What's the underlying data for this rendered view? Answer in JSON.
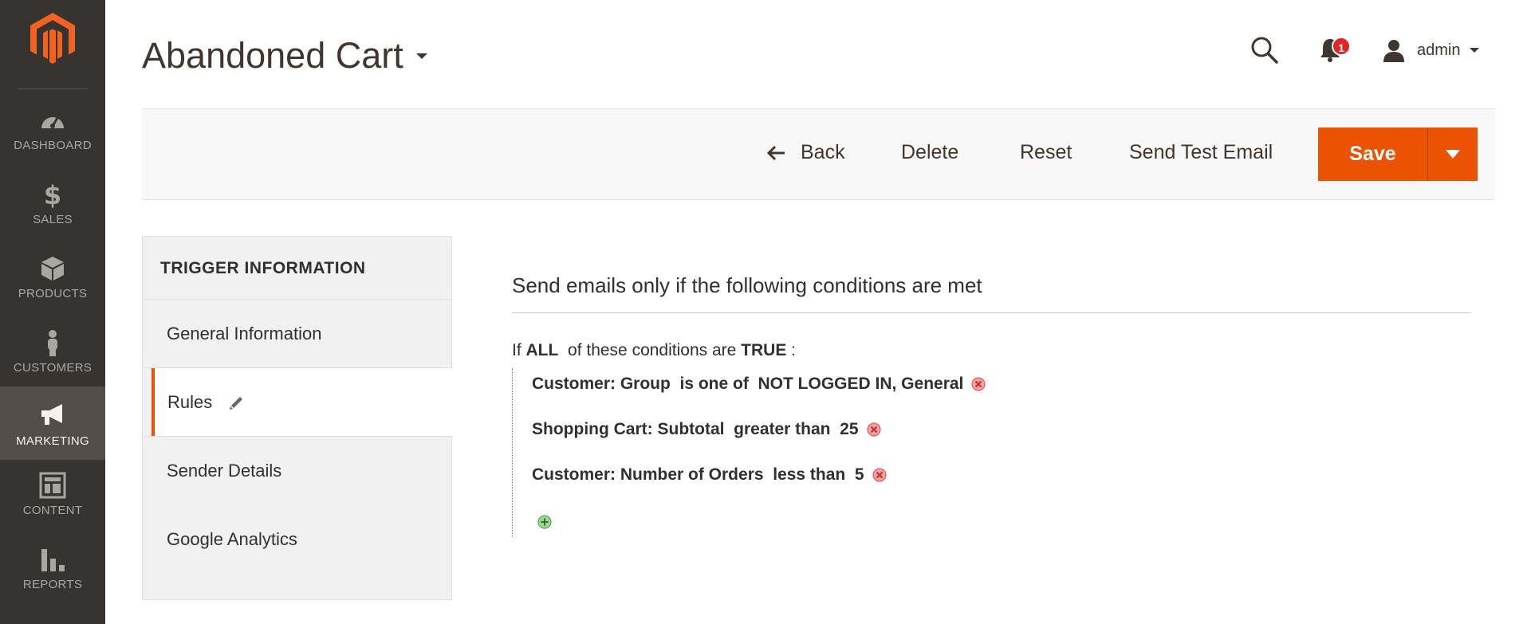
{
  "sidebar": {
    "logo": "magento-logo",
    "items": [
      {
        "label": "DASHBOARD",
        "icon": "dashboard-icon"
      },
      {
        "label": "SALES",
        "icon": "dollar-icon"
      },
      {
        "label": "PRODUCTS",
        "icon": "box-icon"
      },
      {
        "label": "CUSTOMERS",
        "icon": "person-icon"
      },
      {
        "label": "MARKETING",
        "icon": "megaphone-icon",
        "active": true
      },
      {
        "label": "CONTENT",
        "icon": "layout-icon"
      },
      {
        "label": "REPORTS",
        "icon": "bar-chart-icon"
      }
    ]
  },
  "header": {
    "title": "Abandoned Cart",
    "notification_count": "1",
    "user_name": "admin"
  },
  "toolbar": {
    "back_label": "Back",
    "delete_label": "Delete",
    "reset_label": "Reset",
    "send_test_label": "Send Test Email",
    "save_label": "Save"
  },
  "tabs": {
    "title": "TRIGGER INFORMATION",
    "items": [
      {
        "label": "General Information"
      },
      {
        "label": "Rules",
        "active": true
      },
      {
        "label": "Sender Details"
      },
      {
        "label": "Google Analytics"
      }
    ]
  },
  "rules": {
    "section_title": "Send emails only if the following conditions are met",
    "head_prefix": "If ",
    "head_aggregator": "ALL",
    "head_middle": "  of these conditions are ",
    "head_value": "TRUE",
    "head_suffix": " :",
    "conditions": [
      "Customer: Group  is one of  NOT LOGGED IN, General",
      "Shopping Cart: Subtotal  greater than  25",
      "Customer: Number of Orders  less than  5"
    ]
  },
  "colors": {
    "accent": "#eb5202",
    "sidebar_bg": "#373330",
    "sidebar_active": "#524d49",
    "badge": "#e22626"
  }
}
